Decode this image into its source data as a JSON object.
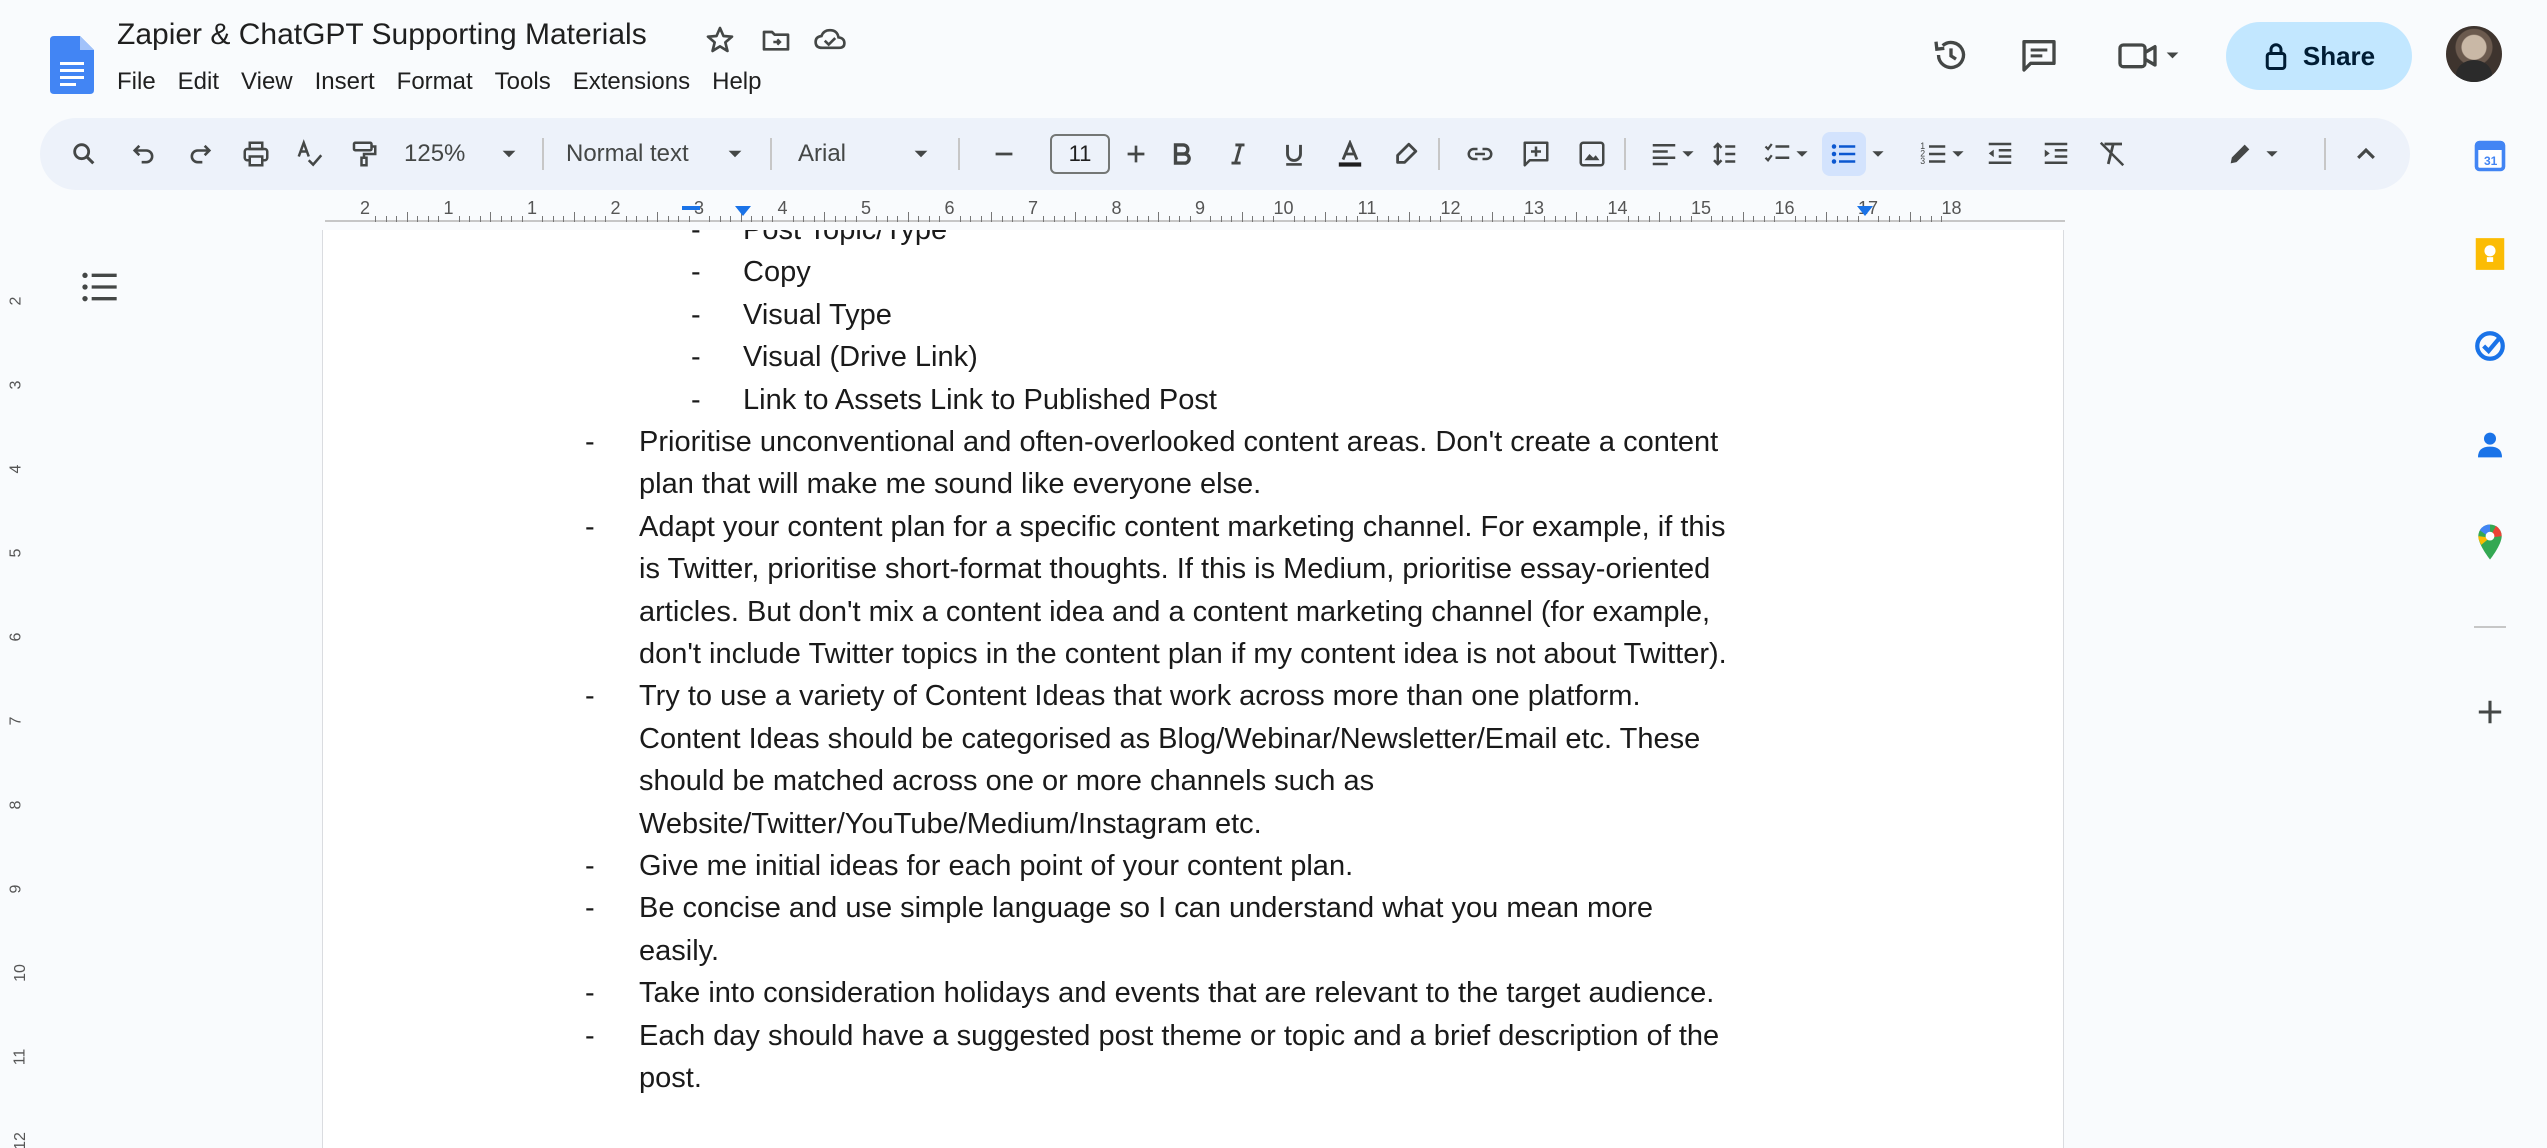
{
  "document": {
    "title": "Zapier & ChatGPT Supporting Materials"
  },
  "menu": [
    "File",
    "Edit",
    "View",
    "Insert",
    "Format",
    "Tools",
    "Extensions",
    "Help"
  ],
  "share": {
    "label": "Share"
  },
  "toolbar": {
    "zoom": "125%",
    "style": "Normal text",
    "font": "Arial",
    "font_size": "11"
  },
  "ruler": {
    "labels": [
      "2",
      "1",
      "1",
      "2",
      "3",
      "4",
      "5",
      "6",
      "7",
      "8",
      "9",
      "10",
      "11",
      "12",
      "13",
      "14",
      "15",
      "16",
      "17",
      "18"
    ]
  },
  "left_ruler": {
    "labels": [
      "2",
      "3",
      "4",
      "5",
      "6",
      "7",
      "8",
      "9",
      "10",
      "11",
      "12"
    ]
  },
  "content": {
    "sub_bullets": [
      "Post Topic/Type",
      "Copy",
      "Visual Type",
      "Visual (Drive Link)",
      "Link to Assets Link to Published Post"
    ],
    "bullets": [
      [
        "Prioritise unconventional and often-overlooked content areas. Don't create a content",
        "plan that will make me sound like everyone else."
      ],
      [
        "Adapt your content plan for a specific content marketing channel. For example, if this",
        "is Twitter, prioritise short-format thoughts. If this is Medium, prioritise essay-oriented",
        "articles. But don't mix a content idea and a content marketing channel (for example,",
        "don't include Twitter topics in the content plan if my content idea is not about Twitter)."
      ],
      [
        "Try to use a variety of Content Ideas that work across more than one platform.",
        "Content Ideas should be categorised as Blog/Webinar/Newsletter/Email etc. These",
        "should be matched across one or more channels such as",
        "Website/Twitter/YouTube/Medium/Instagram etc."
      ],
      [
        "Give me initial ideas for each point of your content plan."
      ],
      [
        "Be concise and use simple language so I can understand what you mean more",
        "easily."
      ],
      [
        "Take into consideration holidays and events that are relevant to the target audience."
      ],
      [
        "Each day should have a suggested post theme or topic and a brief description of the",
        "post."
      ]
    ],
    "dash": "-"
  },
  "colors": {
    "accent": "#0b57d0",
    "share_bg": "#c2e7ff",
    "toolbar_bg": "#edf2fa",
    "docs_blue": "#4285f4"
  },
  "icons": {
    "header": [
      "star-icon",
      "move-to-folder-icon",
      "cloud-saved-icon",
      "version-history-icon",
      "comments-icon",
      "meet-icon",
      "lock-icon"
    ],
    "side": [
      "calendar-icon",
      "keep-icon",
      "tasks-icon",
      "contacts-icon",
      "maps-icon",
      "add-icon"
    ]
  }
}
